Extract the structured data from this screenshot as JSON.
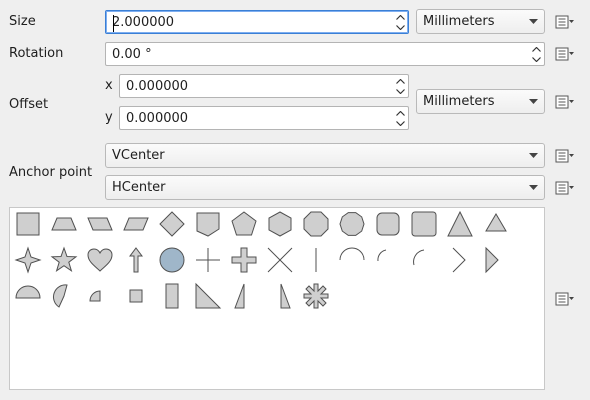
{
  "size": {
    "label": "Size",
    "value": "2.000000",
    "unit": "Millimeters"
  },
  "rotation": {
    "label": "Rotation",
    "value": "0.00 °"
  },
  "offset": {
    "label": "Offset",
    "x_label": "x",
    "x_value": "0.000000",
    "y_label": "y",
    "y_value": "0.000000",
    "unit": "Millimeters"
  },
  "anchor": {
    "label": "Anchor point",
    "vertical": "VCenter",
    "horizontal": "HCenter"
  },
  "symbol_list": {
    "shapes": [
      "square",
      "trapezoid",
      "parallelogram-right",
      "parallelogram-left",
      "diamond",
      "shield",
      "pentagon",
      "hexagon",
      "octagon",
      "decagon",
      "rounded-square-small",
      "rounded-square",
      "triangle",
      "equilateral-triangle",
      "four-pointed-star",
      "star",
      "heart",
      "arrow",
      "circle",
      "cross",
      "cross-fill",
      "cross-2",
      "line",
      "semi-circle",
      "third-circle",
      "quarter-circle",
      "arrowhead",
      "filled-arrowhead",
      "half-circle",
      "third-arc",
      "quarter-circle-filled",
      "small-square",
      "half-square",
      "diagonal-half-square",
      "right-half-triangle",
      "left-half-triangle",
      "asterisk"
    ]
  },
  "colors": {
    "symbol_fill": "#cfcfcf",
    "circle_fill": "#9fb6c9",
    "stroke": "#505050"
  }
}
